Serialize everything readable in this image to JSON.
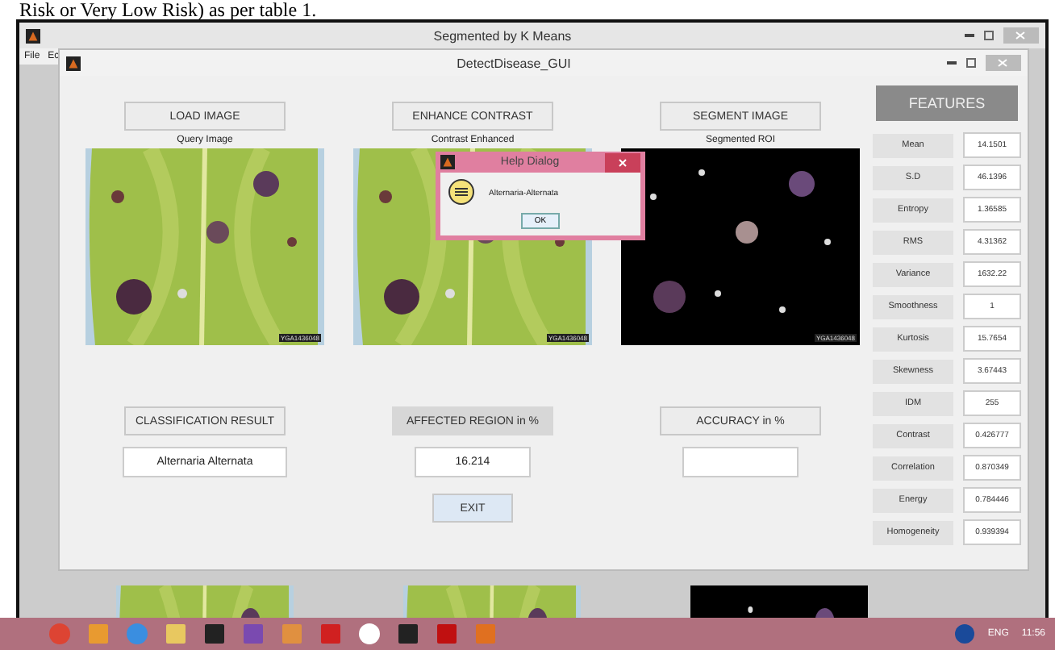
{
  "document_text": "Risk or Very Low Risk) as per table 1.",
  "outer_window": {
    "title": "Segmented by K Means",
    "menu": [
      "File",
      "Ec"
    ]
  },
  "window": {
    "title": "DetectDisease_GUI"
  },
  "panels": [
    {
      "button": "LOAD IMAGE",
      "caption": "Query Image",
      "kind": "leaf",
      "stamp": "YGA1436048"
    },
    {
      "button": "ENHANCE CONTRAST",
      "caption": "Contrast Enhanced",
      "kind": "leaf",
      "stamp": "YGA1436048"
    },
    {
      "button": "SEGMENT IMAGE",
      "caption": "Segmented ROI",
      "kind": "segmented",
      "stamp": "YGA1436048"
    }
  ],
  "results": [
    {
      "label": "CLASSIFICATION RESULT",
      "kind": "button",
      "value": "Alternaria Alternata"
    },
    {
      "label": "AFFECTED REGION in %",
      "kind": "static",
      "value": "16.214"
    },
    {
      "label": "ACCURACY in %",
      "kind": "button"
    }
  ],
  "exit_button": "EXIT",
  "features": {
    "title": "FEATURES",
    "rows": [
      {
        "name": "Mean",
        "value": "14.1501"
      },
      {
        "name": "S.D",
        "value": "46.1396"
      },
      {
        "name": "Entropy",
        "value": "1.36585"
      },
      {
        "name": "RMS",
        "value": "4.31362"
      },
      {
        "name": "Variance",
        "value": "1632.22"
      },
      {
        "name": "Smoothness",
        "value": "1"
      },
      {
        "name": "Kurtosis",
        "value": "15.7654"
      },
      {
        "name": "Skewness",
        "value": "3.67443"
      },
      {
        "name": "IDM",
        "value": "255"
      },
      {
        "name": "Contrast",
        "value": "0.426777"
      },
      {
        "name": "Correlation",
        "value": "0.870349"
      },
      {
        "name": "Energy",
        "value": "0.784446"
      },
      {
        "name": "Homogeneity",
        "value": "0.939394"
      }
    ]
  },
  "dialog": {
    "title": "Help Dialog",
    "message": "Alternaria-Alternata",
    "button": "OK"
  },
  "background_images": [
    {
      "kind": "leaf"
    },
    {
      "kind": "leaf"
    },
    {
      "kind": "segmented"
    }
  ],
  "taskbar": {
    "apps": [
      {
        "kind": "browser"
      },
      {
        "kind": "media"
      },
      {
        "kind": "ie"
      },
      {
        "kind": "folder"
      },
      {
        "kind": "camera"
      },
      {
        "kind": "photos"
      },
      {
        "kind": "figure"
      },
      {
        "kind": "document"
      },
      {
        "kind": "hp"
      },
      {
        "kind": "terminal"
      },
      {
        "kind": "pdf"
      },
      {
        "kind": "matlab"
      }
    ],
    "language": "ENG",
    "time": "11:56"
  }
}
